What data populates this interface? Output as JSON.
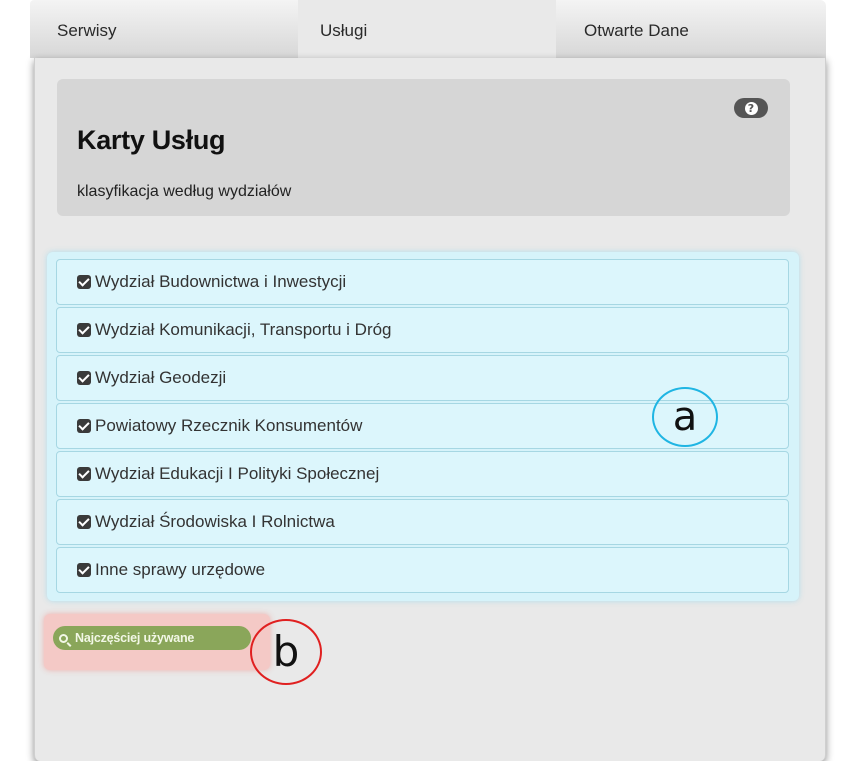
{
  "tabs": [
    {
      "label": "Serwisy",
      "active": false
    },
    {
      "label": "Usługi",
      "active": true
    },
    {
      "label": "Otwarte Dane",
      "active": false
    }
  ],
  "header": {
    "title": "Karty Usług",
    "subtitle": "klasyfikacja według wydziałów",
    "help_icon": "question-circle-icon"
  },
  "list": {
    "items": [
      {
        "label": "Wydział Budownictwa i Inwestycji",
        "icon": "checked-checkbox-icon"
      },
      {
        "label": "Wydział Komunikacji, Transportu i Dróg",
        "icon": "checked-checkbox-icon"
      },
      {
        "label": "Wydział Geodezji",
        "icon": "checked-checkbox-icon"
      },
      {
        "label": "Powiatowy Rzecznik Konsumentów",
        "icon": "checked-checkbox-icon"
      },
      {
        "label": "Wydział Edukacji I Polityki Społecznej",
        "icon": "checked-checkbox-icon"
      },
      {
        "label": "Wydział Środowiska I Rolnictwa",
        "icon": "checked-checkbox-icon"
      },
      {
        "label": "Inne sprawy urzędowe",
        "icon": "checked-checkbox-icon"
      }
    ]
  },
  "most_used": {
    "label": "Najczęściej używane",
    "icon": "search-icon"
  },
  "annotations": {
    "a": "a",
    "b": "b"
  },
  "colors": {
    "list_bg": "#d6f3fa",
    "list_border": "#a6d7e3",
    "button_green": "#8aa65a",
    "highlight_red": "#f4c9c6",
    "annotation_blue": "#1fb5e3",
    "annotation_red": "#e02020"
  }
}
